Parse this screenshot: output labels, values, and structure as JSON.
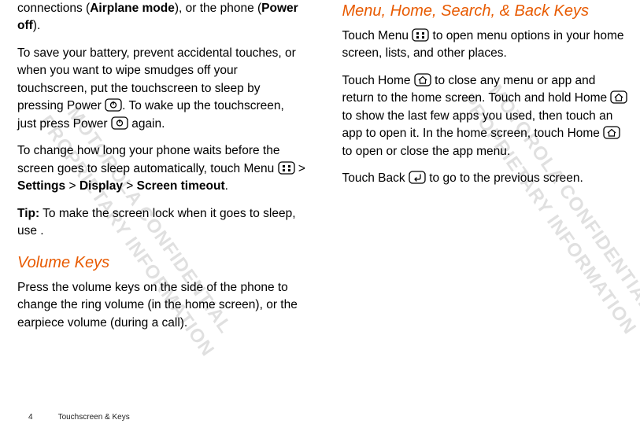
{
  "left": {
    "p1_pre": "connections (",
    "p1_bold1": "Airplane mode",
    "p1_mid": "), or the phone (",
    "p1_bold2": "Power off",
    "p1_end": ").",
    "p2a": "To save your battery, prevent accidental touches, or when you want to wipe smudges off your touchscreen, put the touchscreen to sleep by pressing Power ",
    "p2b": ". To wake up the touchscreen, just press Power ",
    "p2c": " again.",
    "p3a": "To change how long your phone waits before the screen goes to sleep automatically, touch Menu ",
    "p3b": " > ",
    "p3_bold1": "Settings",
    "p3c": " > ",
    "p3_bold2": "Display",
    "p3d": " > ",
    "p3_bold3": "Screen timeout",
    "p3e": ".",
    "p4_bold": "Tip:",
    "p4a": " To make the screen lock when it goes to sleep, use .",
    "heading1": "Volume Keys",
    "p5": "Press the volume keys on the side of the phone to change the ring volume (in the home screen), or the earpiece volume (during a call)."
  },
  "right": {
    "heading2": "Menu, Home, Search, & Back Keys",
    "p6a": "Touch Menu ",
    "p6b": " to open menu options in your home screen, lists, and other places.",
    "p7a": "Touch Home ",
    "p7b": " to close any menu or app and return to the home screen. Touch and hold Home ",
    "p7c": " to show the last few apps you used, then touch an app to open it. In the home screen, touch Home ",
    "p7d": " to open or close the app menu.",
    "p8a": "Touch Back ",
    "p8b": " to go to the previous screen."
  },
  "footer": {
    "page_number": "4",
    "section": "Touchscreen & Keys"
  },
  "watermark": "MOTOROLA CONFIDENTIAL\nPROPRIETARY INFORMATION"
}
